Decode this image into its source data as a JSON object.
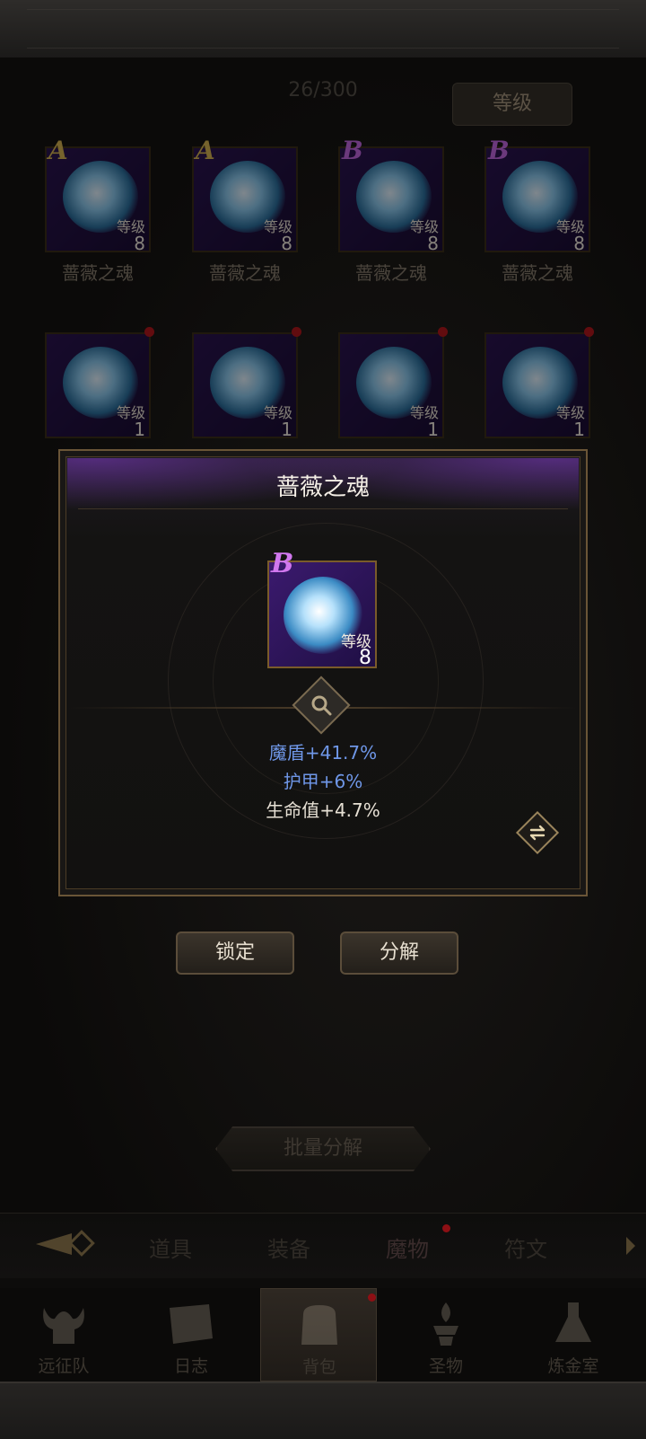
{
  "header": {
    "capacity": "26/300",
    "sort_label": "等级"
  },
  "inventory": {
    "level_label": "等级",
    "row1": [
      {
        "grade": "A",
        "level": "8",
        "name": "蔷薇之魂"
      },
      {
        "grade": "A",
        "level": "8",
        "name": "蔷薇之魂"
      },
      {
        "grade": "B",
        "level": "8",
        "name": "蔷薇之魂"
      },
      {
        "grade": "B",
        "level": "8",
        "name": "蔷薇之魂"
      }
    ],
    "row2": [
      {
        "level": "1"
      },
      {
        "level": "1"
      },
      {
        "level": "1"
      },
      {
        "level": "1"
      }
    ]
  },
  "detail": {
    "title": "蔷薇之魂",
    "grade": "B",
    "level_label": "等级",
    "level": "8",
    "stats": [
      "魔盾+41.7%",
      "护甲+6%",
      "生命值+4.7%"
    ]
  },
  "actions": {
    "lock": "锁定",
    "decompose": "分解",
    "batch_decompose": "批量分解"
  },
  "categories": [
    "道具",
    "装备",
    "魔物",
    "符文"
  ],
  "active_category": "魔物",
  "nav": [
    "远征队",
    "日志",
    "背包",
    "圣物",
    "炼金室"
  ],
  "active_nav": "背包",
  "colors": {
    "grade_A": "#d6b451",
    "grade_B": "#c368e2",
    "stat_blue": "#6f97e8",
    "notify_red": "#b3161b"
  }
}
